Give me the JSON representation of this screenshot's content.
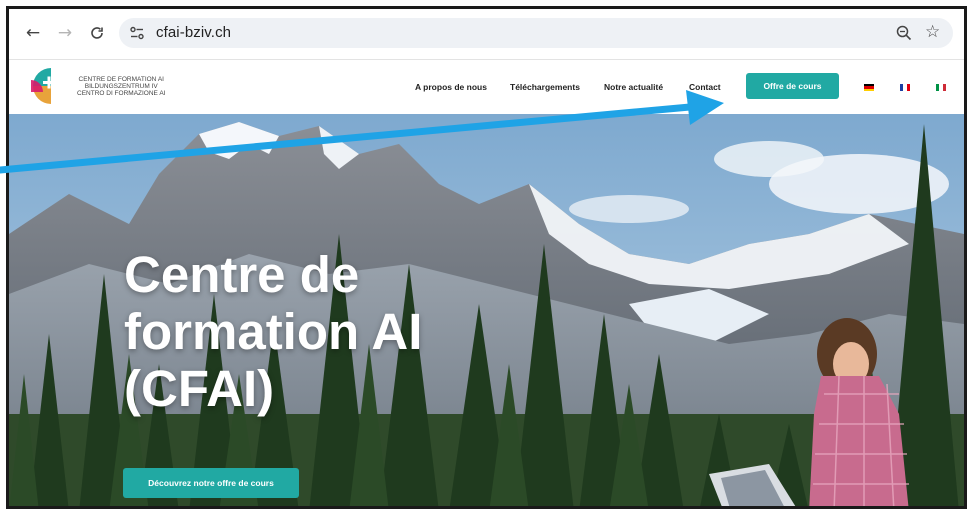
{
  "browser": {
    "url": "cfai-bziv.ch",
    "back_icon": "←",
    "forward_icon": "→",
    "reload_icon": "C",
    "star_icon": "☆"
  },
  "header": {
    "logo_lines": [
      "CENTRE DE FORMATION AI",
      "BILDUNGSZENTRUM IV",
      "CENTRO DI FORMAZIONE AI"
    ],
    "nav": [
      "A propos de nous",
      "Téléchargements",
      "Notre actualité",
      "Contact"
    ],
    "cta_label": "Offre de cours",
    "languages": [
      "de",
      "fr",
      "it"
    ]
  },
  "hero": {
    "title_lines": [
      "Centre de",
      "formation AI",
      "(CFAI)"
    ],
    "button_label": "Découvrez notre offre de cours"
  },
  "colors": {
    "accent": "#21a9a3",
    "annotation_arrow": "#1fa3e6"
  }
}
